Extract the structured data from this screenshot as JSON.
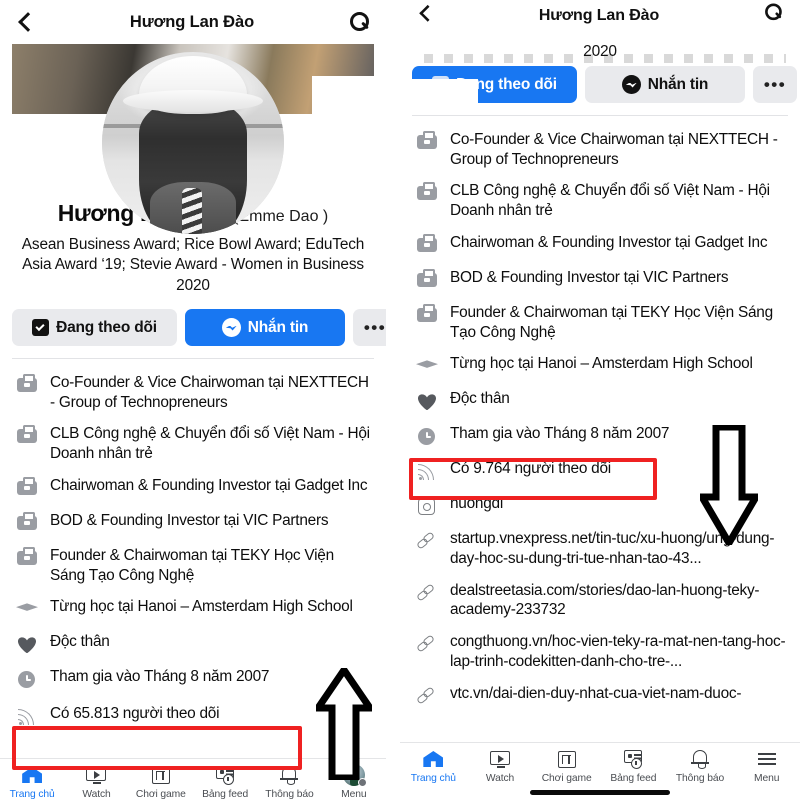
{
  "profile": {
    "header_title": "Hương Lan Đào",
    "back_icon": "back-chevron-icon",
    "search_icon": "search-icon",
    "name": "Hương Lan Đào",
    "alt_name": "(Emme Dao )",
    "bio": "Asean Business Award; Rice Bowl Award; EduTech Asia Award ‘19; Stevie Award - Women in Business 2020",
    "bio_tail_year": "2020"
  },
  "actions": {
    "follow_label": "Đang theo dõi",
    "message_label": "Nhắn tin",
    "more_label": "•••",
    "follow_icon": "following-check-icon",
    "message_icon": "messenger-icon",
    "more_icon": "ellipsis-icon"
  },
  "info_items": [
    {
      "icon": "briefcase-icon",
      "text": "Co-Founder & Vice Chairwoman tại NEXTTECH - Group of Technopreneurs"
    },
    {
      "icon": "briefcase-icon",
      "text": "CLB Công nghệ & Chuyển đổi số Việt Nam - Hội Doanh nhân trẻ"
    },
    {
      "icon": "briefcase-icon",
      "text": "Chairwoman & Founding Investor tại Gadget Inc"
    },
    {
      "icon": "briefcase-icon",
      "text": "BOD & Founding Investor tại VIC Partners"
    },
    {
      "icon": "briefcase-icon",
      "text": "Founder & Chairwoman tại TEKY Học Viện Sáng Tạo Công Nghệ"
    },
    {
      "icon": "graduation-cap-icon",
      "text": "Từng học tại Hanoi – Amsterdam High School"
    },
    {
      "icon": "heart-icon",
      "text": "Độc thân"
    },
    {
      "icon": "clock-icon",
      "text": "Tham gia vào Tháng 8 năm 2007"
    }
  ],
  "followers_left": {
    "icon": "rss-followers-icon",
    "text": "Có 65.813 người theo dõi",
    "highlight_color": "#ef2121"
  },
  "followers_right": {
    "icon": "rss-followers-icon",
    "text": "Có 9.764 người theo dõi",
    "highlight_color": "#ef2121"
  },
  "right_extra_items": [
    {
      "icon": "instagram-icon",
      "text": "huongdl"
    },
    {
      "icon": "link-icon",
      "text": "startup.vnexpress.net/tin-tuc/xu-huong/ung-dung-day-hoc-su-dung-tri-tue-nhan-tao-43..."
    },
    {
      "icon": "link-icon",
      "text": "dealstreetasia.com/stories/dao-lan-huong-teky-academy-233732"
    },
    {
      "icon": "link-icon",
      "text": "congthuong.vn/hoc-vien-teky-ra-mat-nen-tang-hoc-lap-trinh-codekitten-danh-cho-tre-..."
    },
    {
      "icon": "link-icon",
      "text": "vtc.vn/dai-dien-duy-nhat-cua-viet-nam-duoc-"
    }
  ],
  "bottom_nav": {
    "items": [
      {
        "icon": "home-icon",
        "label": "Trang chủ",
        "active": true
      },
      {
        "icon": "watch-icon",
        "label": "Watch",
        "active": false
      },
      {
        "icon": "game-controller-icon",
        "label": "Chơi game",
        "active": false
      },
      {
        "icon": "news-feed-icon",
        "label": "Bảng feed",
        "active": false
      },
      {
        "icon": "bell-icon",
        "label": "Thông báo",
        "active": false
      },
      {
        "icon": "hamburger-menu-icon",
        "label": "Menu",
        "active": false
      }
    ],
    "left_last_icon": "avatar-menu-icon"
  },
  "annotations": {
    "arrow_up": "arrow-up-annotation",
    "arrow_down": "arrow-down-annotation",
    "arrow_color": "#000000"
  },
  "colors": {
    "facebook_blue": "#1877f2",
    "button_grey": "#e9eaed",
    "annotation_red": "#ef2121",
    "icon_grey": "#9a9da3"
  }
}
